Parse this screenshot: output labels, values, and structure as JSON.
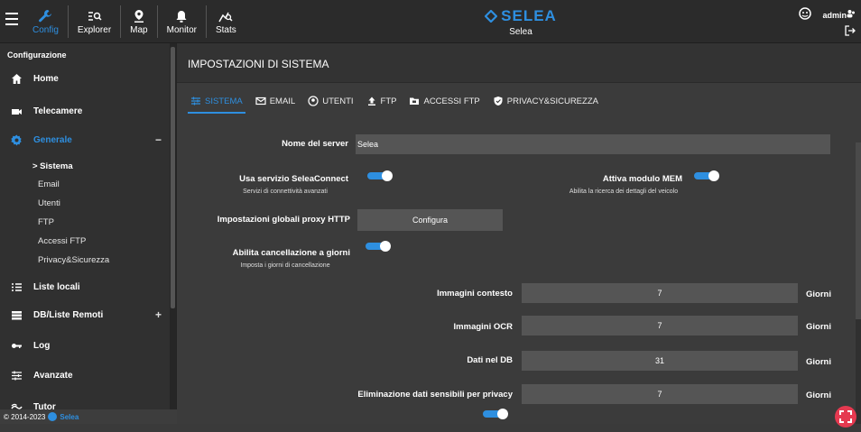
{
  "topnav": [
    {
      "label": "Config",
      "icon": "wrench-icon",
      "active": true
    },
    {
      "label": "Explorer",
      "icon": "explorer-icon",
      "active": false
    },
    {
      "label": "Map",
      "icon": "map-pin-icon",
      "active": false
    },
    {
      "label": "Monitor",
      "icon": "bell-icon",
      "active": false
    },
    {
      "label": "Stats",
      "icon": "stats-icon",
      "active": false
    }
  ],
  "brand": {
    "logo": "SELEA",
    "subtitle": "Selea"
  },
  "user": {
    "name": "admin"
  },
  "sidebar": {
    "title": "Configurazione",
    "items": [
      {
        "label": "Home"
      },
      {
        "label": "Telecamere"
      },
      {
        "label": "Generale",
        "toggle": "−"
      },
      {
        "label": "Liste locali"
      },
      {
        "label": "DB/Liste Remoti",
        "toggle": "+"
      },
      {
        "label": "Log"
      },
      {
        "label": "Avanzate"
      },
      {
        "label": "Tutor"
      }
    ],
    "subitems": [
      "> Sistema",
      "Email",
      "Utenti",
      "FTP",
      "Accessi FTP",
      "Privacy&Sicurezza"
    ],
    "footer": {
      "copyright": "© 2014-2023",
      "brand": "Selea"
    }
  },
  "page": {
    "title": "IMPOSTAZIONI DI SISTEMA"
  },
  "tabs": [
    "SISTEMA",
    "EMAIL",
    "UTENTI",
    "FTP",
    "ACCESSI FTP",
    "PRIVACY&SICUREZZA"
  ],
  "form": {
    "server_name_label": "Nome del server",
    "server_name_value": "Selea",
    "seleaconnect_label": "Usa servizio SeleaConnect",
    "seleaconnect_desc": "Servizi di connettività avanzati",
    "mem_label": "Attiva modulo MEM",
    "mem_desc": "Abilita la ricerca dei dettagli del veicolo",
    "proxy_label": "Impostazioni globali proxy HTTP",
    "proxy_button": "Configura",
    "delete_days_label": "Abilita cancellazione a giorni",
    "delete_days_desc": "Imposta i giorni di cancellazione",
    "retention": [
      {
        "label": "Immagini contesto",
        "value": "7",
        "unit": "Giorni"
      },
      {
        "label": "Immagini OCR",
        "value": "7",
        "unit": "Giorni"
      },
      {
        "label": "Dati nel DB",
        "value": "31",
        "unit": "Giorni"
      },
      {
        "label": "Eliminazione dati sensibili per privacy",
        "value": "7",
        "unit": "Giorni"
      }
    ]
  },
  "colors": {
    "accent": "#2e8fe0",
    "fab": "#e53950"
  }
}
